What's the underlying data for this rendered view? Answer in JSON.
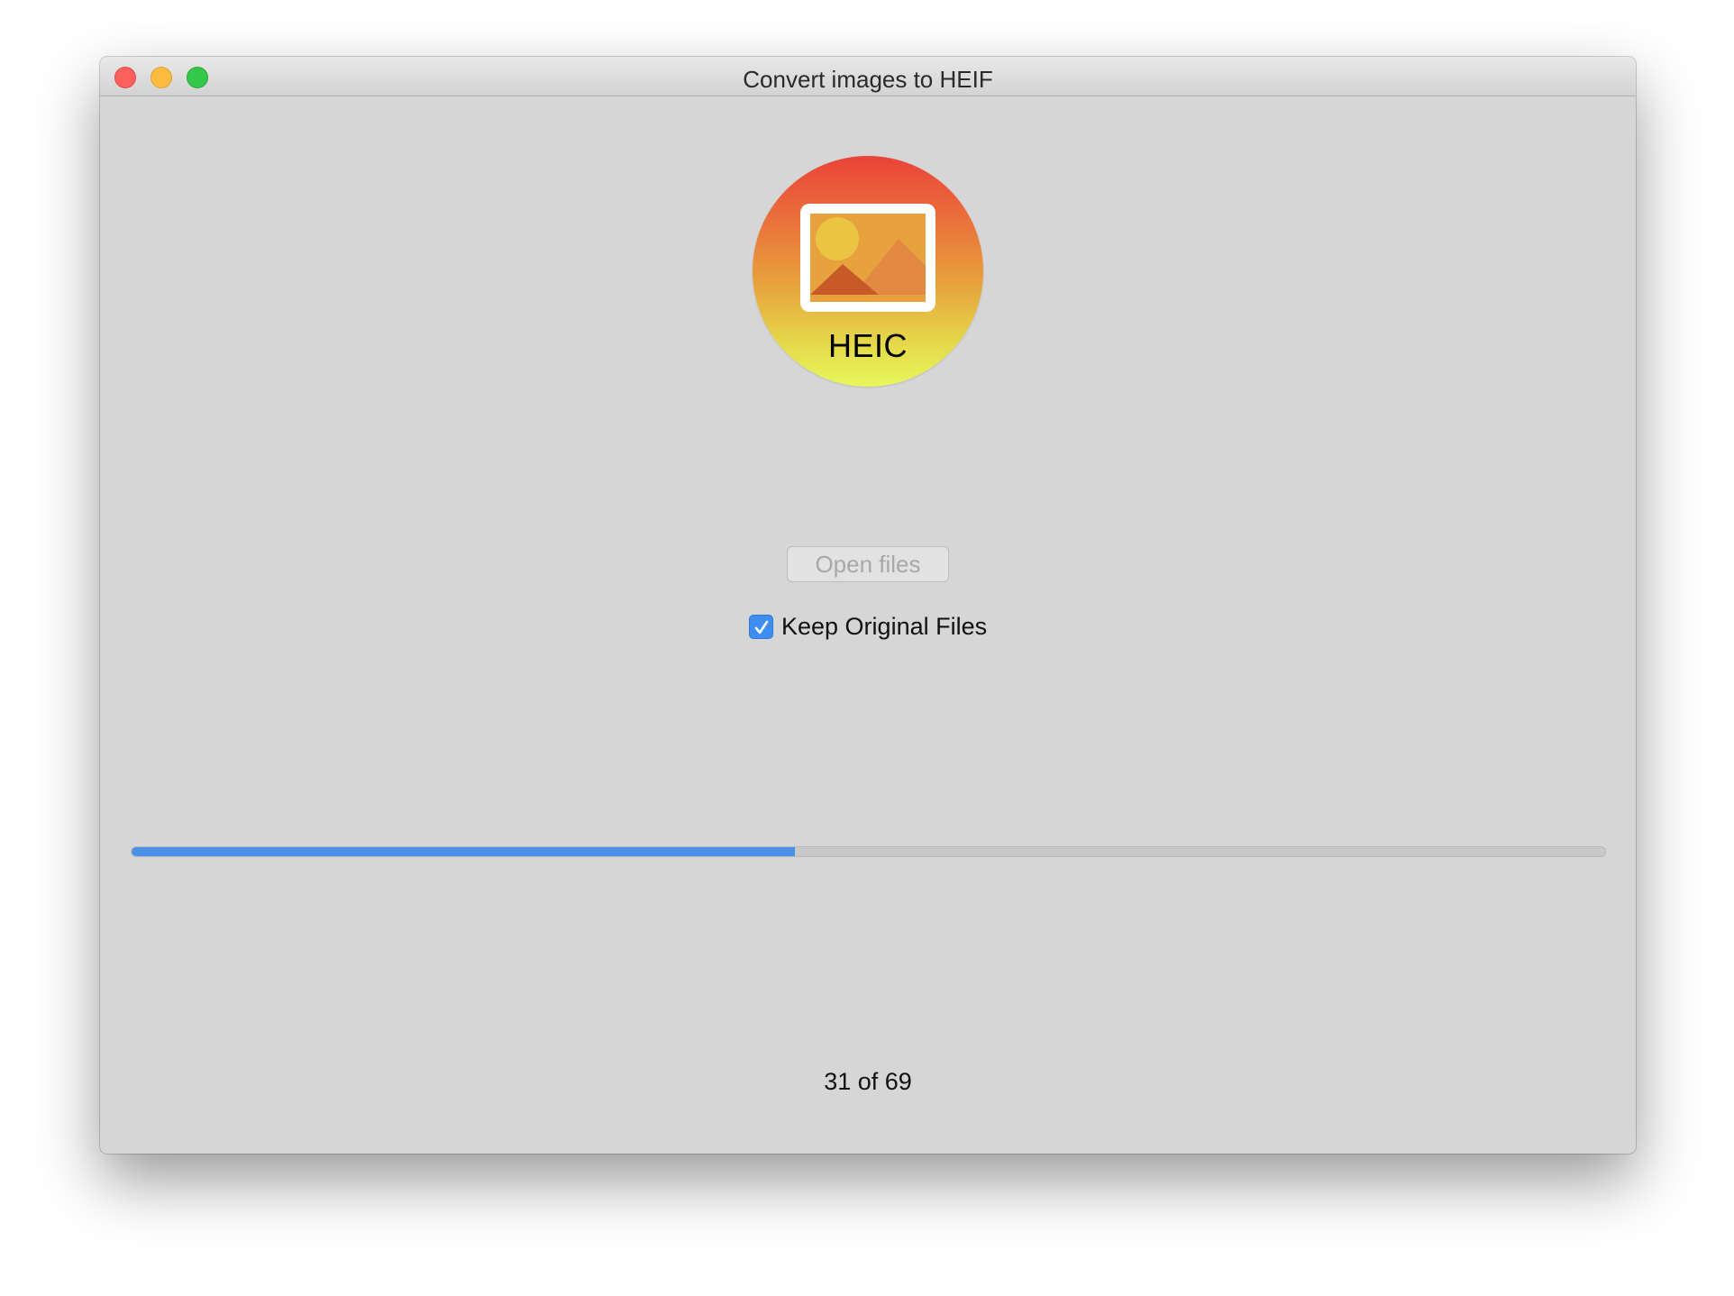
{
  "window": {
    "title": "Convert images to HEIF"
  },
  "app_icon": {
    "label": "HEIC",
    "icon": "image-photo-icon"
  },
  "actions": {
    "open_files_label": "Open files",
    "open_files_enabled": false
  },
  "options": {
    "keep_original_label": "Keep Original Files",
    "keep_original_checked": true
  },
  "progress": {
    "current": 31,
    "total": 69,
    "fraction": 0.45,
    "status_text": "31 of 69"
  },
  "colors": {
    "accent": "#4a90e6",
    "window_bg": "#d6d6d6",
    "close": "#fc605c",
    "minimize": "#fdbc40",
    "zoom": "#34c84a"
  }
}
